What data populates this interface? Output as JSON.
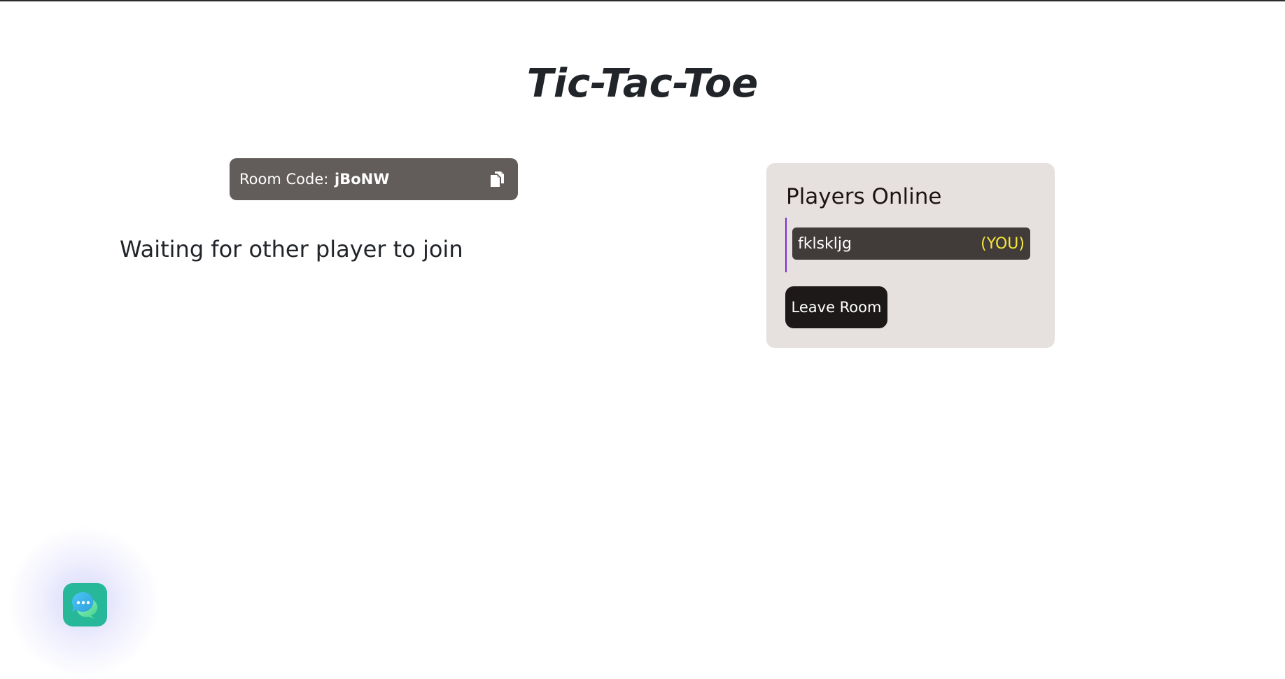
{
  "page": {
    "title": "Tic-Tac-Toe"
  },
  "room": {
    "code_label": "Room Code: ",
    "code_value": "jBoNW",
    "copy_icon": "copy-icon"
  },
  "status": {
    "message": "Waiting for other player to join"
  },
  "players_panel": {
    "title": "Players Online",
    "players": [
      {
        "name": "fklskljg",
        "tag": "(YOU)"
      }
    ],
    "leave_label": "Leave Room"
  },
  "chat": {
    "icon": "chat-bubbles-icon"
  },
  "colors": {
    "room_code_bg": "#625c5a",
    "panel_bg": "#e6e0df",
    "player_row_bg": "#413b3a",
    "you_tag": "#f5e73a",
    "list_accent": "#7a2bd6",
    "leave_button_bg": "#1d1918",
    "chat_fab": "#27b89a"
  }
}
